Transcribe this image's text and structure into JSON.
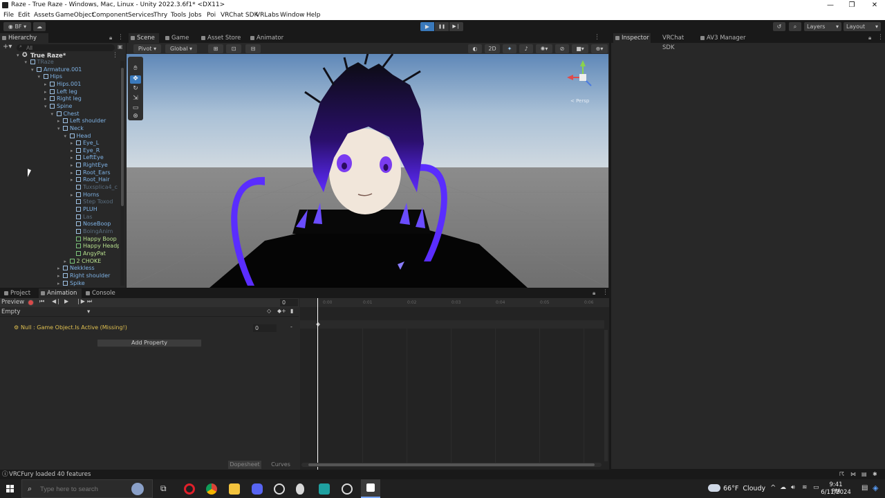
{
  "window": {
    "title": "Raze - True Raze - Windows, Mac, Linux - Unity 2022.3.6f1* <DX11>",
    "minimize": "—",
    "maximize": "❐",
    "close": "✕"
  },
  "menu": [
    "File",
    "Edit",
    "Assets",
    "GameObject",
    "Component",
    "Services",
    "Thry",
    "Tools",
    "Jobs",
    "Poi",
    "VRChat SDK",
    "VRLabs",
    "Window",
    "Help"
  ],
  "toolbar": {
    "account": "BF",
    "play": "▶",
    "pause": "❚❚",
    "step": "▶❘",
    "layers": "Layers",
    "layout": "Layout"
  },
  "hierarchy": {
    "tab": "Hierarchy",
    "search_placeholder": "All",
    "scene_root": "True Raze*",
    "rows": [
      {
        "label": "TRaze",
        "indent": 1,
        "arrow": "▾",
        "style": "dim"
      },
      {
        "label": "Armature.001",
        "indent": 2,
        "arrow": "▾",
        "style": ""
      },
      {
        "label": "Hips",
        "indent": 3,
        "arrow": "▾",
        "style": ""
      },
      {
        "label": "Hips.001",
        "indent": 4,
        "arrow": "▸",
        "style": ""
      },
      {
        "label": "Left leg",
        "indent": 4,
        "arrow": "▸",
        "style": ""
      },
      {
        "label": "Right leg",
        "indent": 4,
        "arrow": "▸",
        "style": ""
      },
      {
        "label": "Spine",
        "indent": 4,
        "arrow": "▾",
        "style": ""
      },
      {
        "label": "Chest",
        "indent": 5,
        "arrow": "▾",
        "style": ""
      },
      {
        "label": "Left shoulder",
        "indent": 6,
        "arrow": "▸",
        "style": ""
      },
      {
        "label": "Neck",
        "indent": 6,
        "arrow": "▾",
        "style": ""
      },
      {
        "label": "Head",
        "indent": 7,
        "arrow": "▾",
        "style": ""
      },
      {
        "label": "Eye_L",
        "indent": 8,
        "arrow": "▸",
        "style": ""
      },
      {
        "label": "Eye_R",
        "indent": 8,
        "arrow": "▸",
        "style": ""
      },
      {
        "label": "LeftEye",
        "indent": 8,
        "arrow": "▸",
        "style": ""
      },
      {
        "label": "RightEye",
        "indent": 8,
        "arrow": "▸",
        "style": ""
      },
      {
        "label": "Root_Ears",
        "indent": 8,
        "arrow": "▸",
        "style": ""
      },
      {
        "label": "Root_Hair",
        "indent": 8,
        "arrow": "▸",
        "style": ""
      },
      {
        "label": "Tuxsplica4_c",
        "indent": 8,
        "arrow": "",
        "style": "dim"
      },
      {
        "label": "Horns",
        "indent": 8,
        "arrow": "▸",
        "style": ""
      },
      {
        "label": "Step Toxod",
        "indent": 8,
        "arrow": "",
        "style": "dim"
      },
      {
        "label": "PLUH",
        "indent": 8,
        "arrow": "",
        "style": ""
      },
      {
        "label": "Las",
        "indent": 8,
        "arrow": "",
        "style": "dim"
      },
      {
        "label": "NoseBoop",
        "indent": 8,
        "arrow": "",
        "style": ""
      },
      {
        "label": "BoingAnim",
        "indent": 8,
        "arrow": "",
        "style": "dim"
      },
      {
        "label": "Happy Boop",
        "indent": 8,
        "arrow": "",
        "style": "green"
      },
      {
        "label": "Happy Headps",
        "indent": 8,
        "arrow": "",
        "style": "green"
      },
      {
        "label": "AngyPat",
        "indent": 8,
        "arrow": "",
        "style": "green"
      },
      {
        "label": "2 CHOKE",
        "indent": 7,
        "arrow": "▸",
        "style": "green"
      },
      {
        "label": "Nekkless",
        "indent": 6,
        "arrow": "▸",
        "style": ""
      },
      {
        "label": "Right shoulder",
        "indent": 6,
        "arrow": "▸",
        "style": ""
      },
      {
        "label": "Spike",
        "indent": 6,
        "arrow": "▸",
        "style": ""
      }
    ]
  },
  "scene_tabs": [
    "Scene",
    "Game",
    "Asset Store",
    "Animator"
  ],
  "scene_toolbar": {
    "pivot": "Pivot",
    "global": "Global",
    "mode_2d": "2D",
    "persp": "< Persp"
  },
  "inspector_tabs": [
    "Inspector",
    "VRChat SDK",
    "AV3 Manager"
  ],
  "bottom_tabs": [
    "Project",
    "Animation",
    "Console"
  ],
  "animation": {
    "preview": "Preview",
    "frame": "0",
    "clip": "Empty",
    "property_row": "Null : Game Object.Is Active (Missing!)",
    "property_value": "0",
    "add_property": "Add Property",
    "timeline_marks": [
      "0:00",
      "0:01",
      "0:02",
      "0:03",
      "0:04",
      "0:05",
      "0:06"
    ],
    "dopesheet": "Dopesheet",
    "curves": "Curves"
  },
  "status": {
    "message": "VRCFury loaded 40 features"
  },
  "taskbar": {
    "search_placeholder": "Type here to search",
    "weather": "66°F  Cloudy",
    "time": "9:41 PM",
    "date": "6/11/2024"
  },
  "colors": {
    "accent_play": "#3a79bb",
    "hierarchy_text": "#7fb3e6",
    "prefab_green": "#b8e08e",
    "warning": "#e0c050"
  }
}
